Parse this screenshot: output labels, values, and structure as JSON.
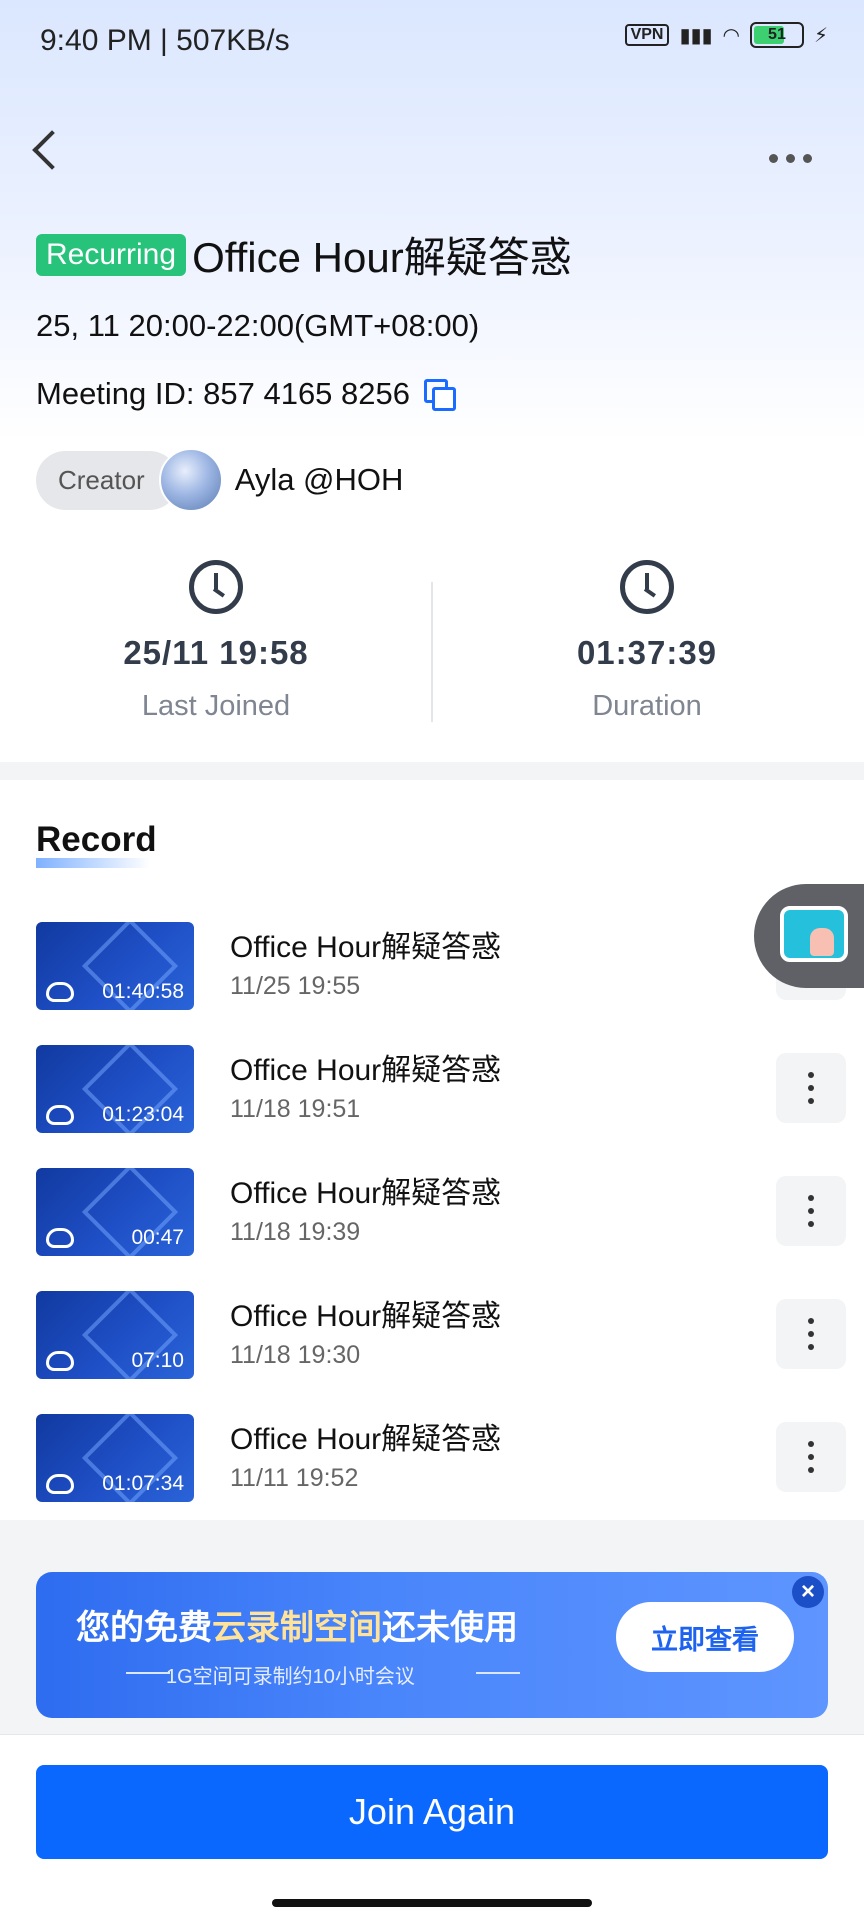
{
  "status_bar": {
    "time": "9:40 PM | 507KB/s",
    "vpn": "VPN",
    "battery": "51"
  },
  "header": {
    "badge": "Recurring",
    "title": "Office Hour解疑答惑"
  },
  "meeting": {
    "time": "25, 11 20:00-22:00(GMT+08:00)",
    "id_label": "Meeting ID: 857 4165 8256",
    "creator_label": "Creator",
    "creator_name": "Ayla @HOH"
  },
  "stats": [
    {
      "value": "25/11 19:58",
      "label": "Last Joined",
      "icon": "history-icon"
    },
    {
      "value": "01:37:39",
      "label": "Duration",
      "icon": "clock-icon"
    }
  ],
  "record": {
    "title": "Record",
    "items": [
      {
        "title": "Office Hour解疑答惑",
        "date": "11/25 19:55",
        "duration": "01:40:58"
      },
      {
        "title": "Office Hour解疑答惑",
        "date": "11/18 19:51",
        "duration": "01:23:04"
      },
      {
        "title": "Office Hour解疑答惑",
        "date": "11/18 19:39",
        "duration": "00:47"
      },
      {
        "title": "Office Hour解疑答惑",
        "date": "11/18 19:30",
        "duration": "07:10"
      },
      {
        "title": "Office Hour解疑答惑",
        "date": "11/11 19:52",
        "duration": "01:07:34"
      }
    ]
  },
  "banner": {
    "title_part1": "您的免费",
    "title_highlight": "云录制空间",
    "title_part2": "还未使用",
    "subtitle": "1G空间可录制约10小时会议",
    "button": "立即查看",
    "close": "×"
  },
  "footer": {
    "join_button": "Join Again"
  }
}
